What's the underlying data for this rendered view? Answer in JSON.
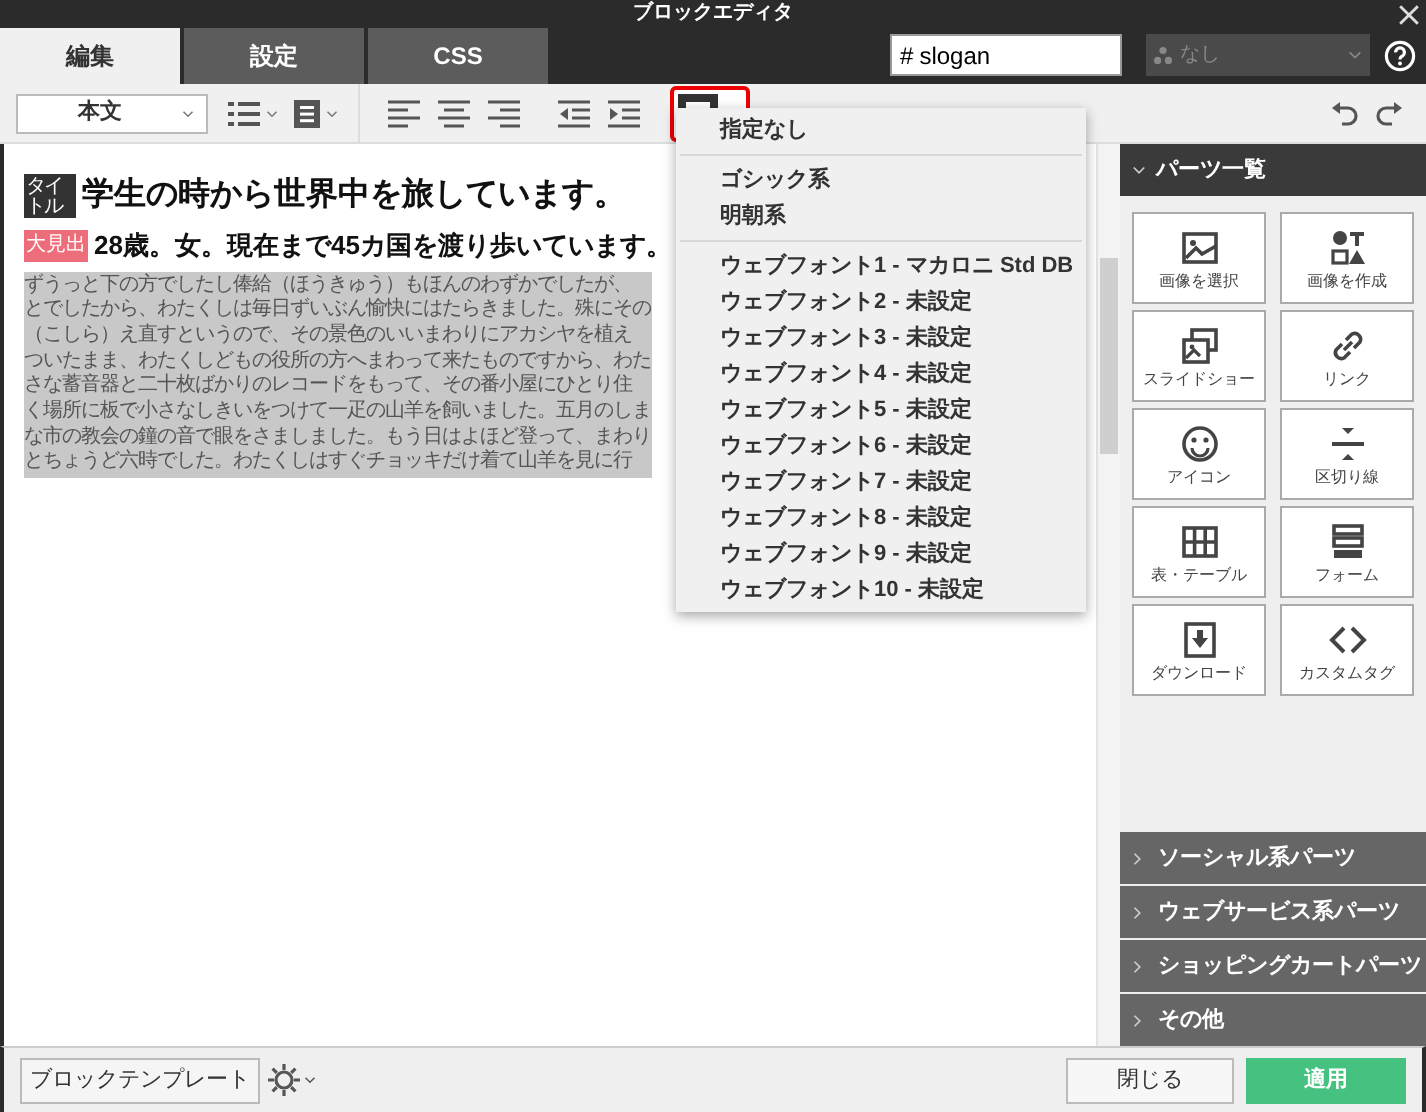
{
  "window": {
    "title": "ブロックエディタ"
  },
  "tabs": [
    {
      "label": "編集",
      "selected": true
    },
    {
      "label": "設定",
      "selected": false
    },
    {
      "label": "CSS",
      "selected": false
    }
  ],
  "id_field": {
    "prefix": "#",
    "value": "slogan"
  },
  "class_select": {
    "value": "なし",
    "disabled": true
  },
  "toolbar": {
    "style_select": "本文"
  },
  "editor": {
    "blocks": [
      {
        "kind": "heading",
        "tag": "タイトル",
        "text": "学生の時から世界中を旅しています。"
      },
      {
        "kind": "subheading",
        "tag": "大見出",
        "text": "28歳。女。現在まで45カ国を渡り歩いています。"
      },
      {
        "kind": "paragraph",
        "selected": true,
        "lines": [
          "ずうっと下の方でしたし俸給（ほうきゅう）もほんのわずかでしたが、",
          "とでしたから、わたくしは毎日ずいぶん愉快にはたらきました。殊にその",
          "（こしら）え直すというので、その景色のいいまわりにアカシヤを植え",
          "ついたまま、わたくしどもの役所の方へまわって来たものですから、わた",
          "さな蓄音器と二十枚ばかりのレコードをもって、その番小屋にひとり住",
          "く場所に板で小さなしきいをつけて一疋の山羊を飼いました。五月のしま",
          "な市の教会の鐘の音で眼をさましました。もう日はよほど登って、まわり",
          "とちょうど六時でした。わたくしはすぐチョッキだけ着て山羊を見に行"
        ]
      }
    ]
  },
  "font_menu": {
    "groups": [
      {
        "items": [
          "指定なし"
        ]
      },
      {
        "items": [
          "ゴシック系",
          "明朝系"
        ]
      },
      {
        "items": [
          "ウェブフォント1 - マカロニ Std DB",
          "ウェブフォント2 - 未設定",
          "ウェブフォント3 - 未設定",
          "ウェブフォント4 - 未設定",
          "ウェブフォント5 - 未設定",
          "ウェブフォント6 - 未設定",
          "ウェブフォント7 - 未設定",
          "ウェブフォント8 - 未設定",
          "ウェブフォント9 - 未設定",
          "ウェブフォント10 - 未設定"
        ]
      }
    ]
  },
  "parts_panel": {
    "title": "パーツ一覧",
    "expanded": true,
    "items": [
      {
        "label": "画像を選択",
        "kind": "image"
      },
      {
        "label": "画像を作成",
        "kind": "shapes"
      },
      {
        "label": "スライドショー",
        "kind": "slides"
      },
      {
        "label": "リンク",
        "kind": "link"
      },
      {
        "label": "アイコン",
        "kind": "smile"
      },
      {
        "label": "区切り線",
        "kind": "divider"
      },
      {
        "label": "表・テーブル",
        "kind": "table"
      },
      {
        "label": "フォーム",
        "kind": "form"
      },
      {
        "label": "ダウンロード",
        "kind": "download"
      },
      {
        "label": "カスタムタグ",
        "kind": "code"
      }
    ]
  },
  "sections": [
    {
      "label": "ソーシャル系パーツ",
      "expanded": false
    },
    {
      "label": "ウェブサービス系パーツ",
      "expanded": false
    },
    {
      "label": "ショッピングカートパーツ",
      "expanded": false
    },
    {
      "label": "その他",
      "expanded": false
    }
  ],
  "footer": {
    "template_button": "ブロックテンプレート",
    "close_button": "閉じる",
    "apply_button": "適用"
  }
}
